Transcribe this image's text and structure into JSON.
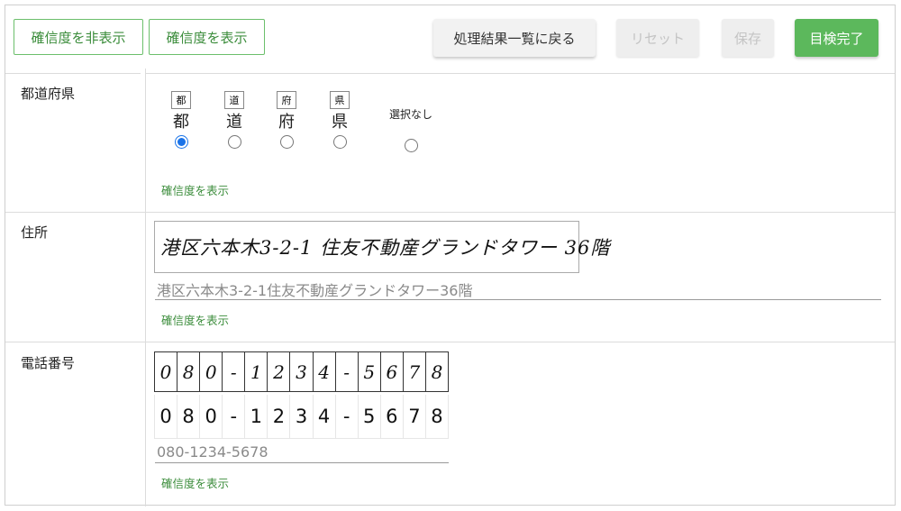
{
  "toolbar": {
    "hide_confidence": "確信度を非表示",
    "show_confidence": "確信度を表示",
    "back_to_list": "処理結果一覧に戻る",
    "reset": "リセット",
    "save": "保存",
    "complete": "目検完了"
  },
  "prefecture": {
    "label": "都道府県",
    "options": [
      {
        "thumb": "都",
        "label": "都",
        "checked": true
      },
      {
        "thumb": "道",
        "label": "道",
        "checked": false
      },
      {
        "thumb": "府",
        "label": "府",
        "checked": false
      },
      {
        "thumb": "県",
        "label": "県",
        "checked": false
      }
    ],
    "none_label": "選択なし",
    "confidence_link": "確信度を表示"
  },
  "address": {
    "label": "住所",
    "handwritten": "港区六本木3-2-1 住友不動産グランドタワー 36階",
    "value": "港区六本木3-2-1住友不動産グランドタワー36階",
    "confidence_link": "確信度を表示"
  },
  "phone": {
    "label": "電話番号",
    "handwritten_chars": [
      "0",
      "8",
      "0",
      "-",
      "1",
      "2",
      "3",
      "4",
      "-",
      "5",
      "6",
      "7",
      "8"
    ],
    "ocr_chars": [
      "0",
      "8",
      "0",
      "-",
      "1",
      "2",
      "3",
      "4",
      "-",
      "5",
      "6",
      "7",
      "8"
    ],
    "value": "080-1234-5678",
    "confidence_link": "確信度を表示"
  },
  "colors": {
    "accent_green": "#5cb85c",
    "link_green": "#3c8d3c",
    "radio_blue": "#1a73e8"
  }
}
